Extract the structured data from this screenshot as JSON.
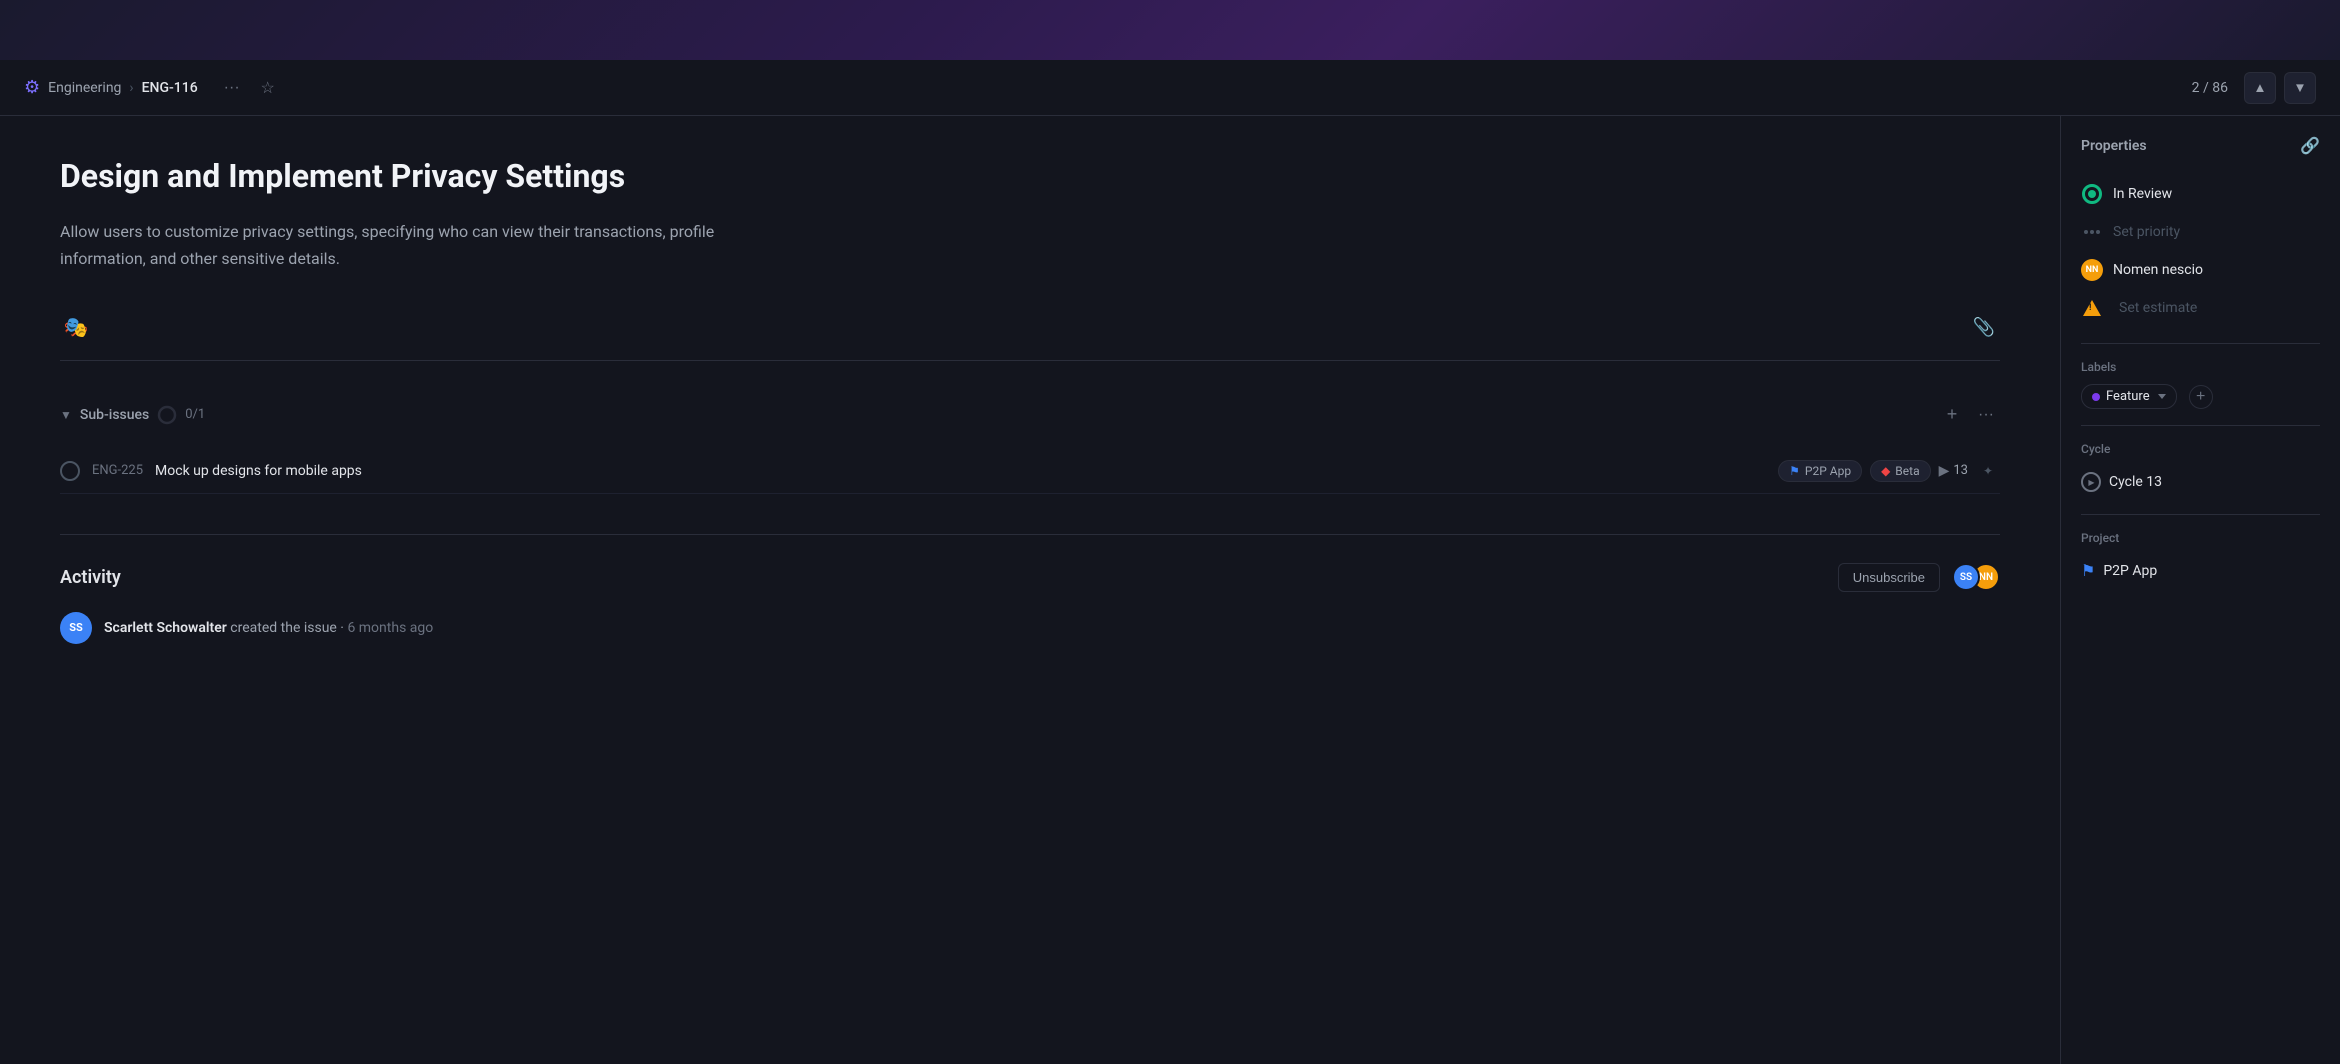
{
  "topBar": {},
  "header": {
    "breadcrumb": {
      "icon": "⚙",
      "parent": "Engineering",
      "separator": "›",
      "current": "ENG-116"
    },
    "moreLabel": "···",
    "starLabel": "☆",
    "pagination": {
      "current": "2",
      "total": "86",
      "display": "2 / 86"
    },
    "navUp": "▲",
    "navDown": "▼"
  },
  "issue": {
    "title": "Design and Implement Privacy Settings",
    "description": "Allow users to customize privacy settings, specifying who can view their transactions, profile\ninformation, and other sensitive details."
  },
  "subIssues": {
    "label": "Sub-issues",
    "count": "0/1",
    "items": [
      {
        "id": "ENG-225",
        "title": "Mock up designs for mobile apps",
        "tags": [
          {
            "name": "P2P App",
            "color": "#3b82f6"
          },
          {
            "name": "Beta",
            "color": "#ef4444"
          }
        ],
        "cycleNumber": "13"
      }
    ]
  },
  "activity": {
    "title": "Activity",
    "unsubscribeLabel": "Unsubscribe",
    "items": [
      {
        "author": "Scarlett Schowalter",
        "action": "created the issue",
        "time": "6 months ago",
        "initials": "SS"
      }
    ]
  },
  "properties": {
    "panelTitle": "Properties",
    "status": {
      "label": "In Review",
      "color": "#10b981"
    },
    "priority": {
      "label": "Set priority"
    },
    "assignee": {
      "label": "Nomen nescio",
      "initials": "NN"
    },
    "estimate": {
      "label": "Set estimate"
    }
  },
  "labels": {
    "sectionTitle": "Labels",
    "items": [
      {
        "name": "Feature",
        "color": "#7c3aed"
      }
    ],
    "addLabel": "+"
  },
  "cycle": {
    "sectionTitle": "Cycle",
    "name": "Cycle 13"
  },
  "project": {
    "sectionTitle": "Project",
    "name": "P2P App"
  }
}
